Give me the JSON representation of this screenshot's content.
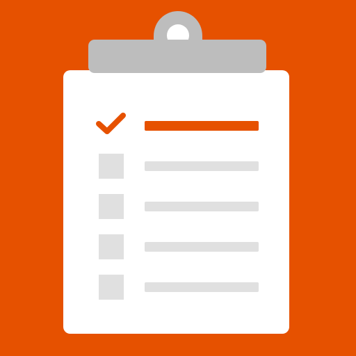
{
  "icon": {
    "name": "clipboard-checklist-icon",
    "colors": {
      "background": "#E65100",
      "board": "#FFFFFF",
      "clip": "#BDBDBD",
      "accent": "#E65100",
      "pending": "#E0E0E0",
      "check": "#E65100"
    },
    "items": [
      {
        "checked": true
      },
      {
        "checked": false
      },
      {
        "checked": false
      },
      {
        "checked": false
      },
      {
        "checked": false
      }
    ]
  }
}
